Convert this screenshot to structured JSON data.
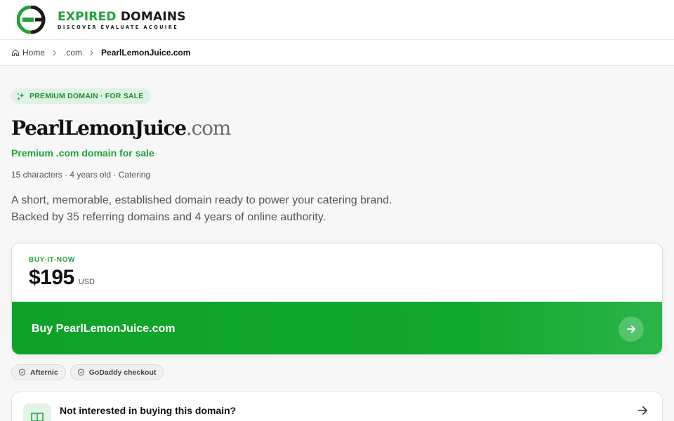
{
  "brand": {
    "name_part1": "EXPIRED",
    "name_part2": "DOMAINS",
    "tagline": "DISCOVER EVALUATE ACQUIRE",
    "logo_icon": "ed-logo-icon",
    "accent": "#21a33a"
  },
  "breadcrumb": {
    "home": "Home",
    "tld": ".com",
    "current": "PearlLemonJuice.com"
  },
  "badge": {
    "label": "PREMIUM DOMAIN · FOR SALE",
    "icon": "sparkle-icon"
  },
  "domain": {
    "name": "PearlLemonJuice",
    "tld": ".com",
    "subtitle": "Premium .com domain for sale",
    "meta": "15 characters · 4 years old · Catering",
    "description_line1": "A short, memorable, established domain ready to power your catering brand.",
    "description_line2": "Backed by 35 referring domains and 4 years of online authority."
  },
  "purchase": {
    "label": "BUY-IT-NOW",
    "price": "$195",
    "currency": "USD",
    "button_label": "Buy PearlLemonJuice.com",
    "button_color": "#12a82d"
  },
  "trust_chips": [
    {
      "label": "Afternic",
      "icon": "shield-icon"
    },
    {
      "label": "GoDaddy checkout",
      "icon": "shield-icon"
    }
  ],
  "alternative": {
    "text": "Not interested in buying this domain?",
    "icon": "book-icon"
  }
}
